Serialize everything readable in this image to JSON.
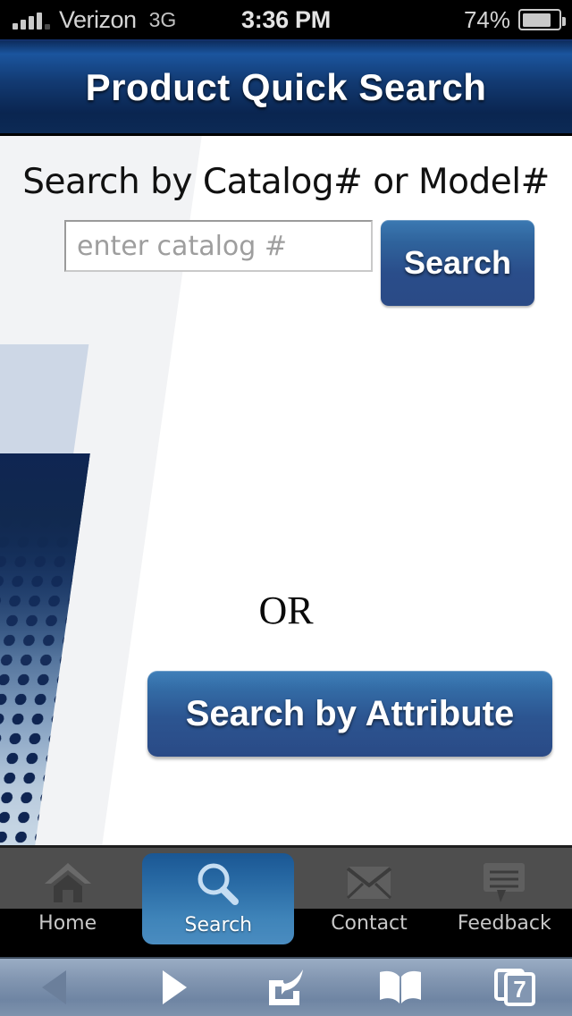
{
  "status_bar": {
    "carrier": "Verizon",
    "network": "3G",
    "time": "3:36 PM",
    "battery_percent": "74%",
    "signal_icon": "signal-bars-icon",
    "battery_icon": "battery-icon"
  },
  "header": {
    "title": "Product Quick Search",
    "background_color": "#0a2550"
  },
  "main": {
    "heading": "Search by Catalog# or Model#",
    "catalog_input": {
      "value": "",
      "placeholder": "enter catalog #"
    },
    "search_button_label": "Search",
    "divider_label": "OR",
    "attribute_button_label": "Search by Attribute",
    "accent_color": "#2a4a86"
  },
  "tab_bar": {
    "active_tab": "Search",
    "active_color": "#3f84b9",
    "tabs": [
      {
        "label": "Home",
        "icon": "home-icon",
        "active": false
      },
      {
        "label": "Search",
        "icon": "magnifier-icon",
        "active": true
      },
      {
        "label": "Contact",
        "icon": "envelope-icon",
        "active": false
      },
      {
        "label": "Feedback",
        "icon": "speech-bubble-icon",
        "active": false
      }
    ]
  },
  "browser_toolbar": {
    "back_icon": "back-arrow-icon",
    "forward_icon": "forward-arrow-icon",
    "share_icon": "share-icon",
    "bookmarks_icon": "book-icon",
    "tabs_icon": "tabs-icon",
    "tab_count": "7"
  }
}
